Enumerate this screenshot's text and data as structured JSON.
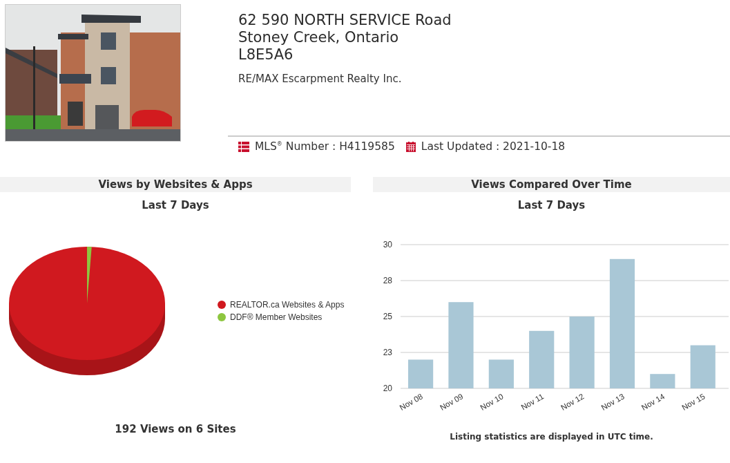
{
  "listing": {
    "address_lines": [
      "62 590 NORTH SERVICE Road",
      "Stoney Creek, Ontario",
      "L8E5A6"
    ],
    "agency": "RE/MAX Escarpment Realty Inc.",
    "mls_label": "MLS$^{®}$ Number : H4119585",
    "updated_label": "Last Updated : 2021-10-18"
  },
  "sites_panel": {
    "title": "Views by Websites & Apps",
    "subtitle": "Last 7 Days",
    "legend": [
      {
        "label": "REALTOR.ca Websites & Apps",
        "color": "#d0191f"
      },
      {
        "label": "DDF® Member Websites",
        "color": "#8dc63f"
      }
    ],
    "summary": "192 Views on 6 Sites"
  },
  "time_panel": {
    "title": "Views Compared Over Time",
    "subtitle": "Last 7 Days",
    "note": "Listing statistics are displayed in UTC time.",
    "chart_data": {
      "type": "bar",
      "categories": [
        "Nov 08",
        "Nov 09",
        "Nov 10",
        "Nov 11",
        "Nov 12",
        "Nov 13",
        "Nov 14",
        "Nov 15"
      ],
      "grid": true,
      "series": [
        {
          "color": "#a9c7d6",
          "values": [
            22,
            26,
            22,
            24,
            25,
            29,
            21,
            23
          ]
        }
      ],
      "ylim": [
        20,
        30
      ],
      "yticks": [
        20,
        {
          "value": 22.5,
          "label": "23"
        },
        25,
        {
          "value": 27.5,
          "label": "28"
        },
        30
      ]
    }
  }
}
